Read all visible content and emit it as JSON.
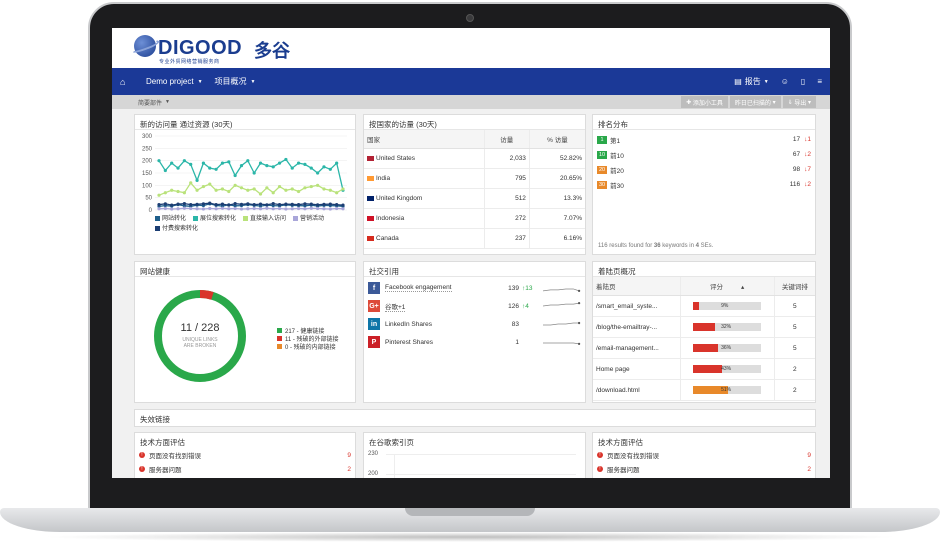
{
  "brand": {
    "name": "DIGOOD",
    "name_cn": "多谷",
    "tagline": "专业外贸网络营销服务商"
  },
  "nav": {
    "home_icon": "home-icon",
    "project": "Demo project",
    "overview": "项目概况",
    "report": "报告",
    "right_icons": [
      "users-icon",
      "book-icon",
      "menu-icon"
    ]
  },
  "toolbar": {
    "left": "简要部件",
    "add_widget": "添加小工具",
    "date": "昨日已扫描的",
    "export": "导出"
  },
  "traffic": {
    "title": "新的访问量 通过资源 (30天)",
    "chart_data": {
      "type": "line",
      "ylim": [
        0,
        300
      ],
      "yticks": [
        0,
        50,
        100,
        150,
        200,
        250,
        300
      ],
      "series": [
        {
          "name": "网站转化",
          "color": "#1f5f8b",
          "values": [
            15,
            18,
            16,
            22,
            17,
            15,
            20,
            18,
            25,
            19,
            16,
            21,
            17,
            18,
            22,
            19,
            16,
            20,
            18,
            17,
            21,
            19,
            18,
            17,
            20,
            16,
            19,
            18,
            17,
            15
          ]
        },
        {
          "name": "展位搜索转化",
          "color": "#2bb6a8",
          "values": [
            200,
            160,
            190,
            170,
            200,
            185,
            120,
            190,
            170,
            165,
            190,
            195,
            140,
            180,
            200,
            150,
            190,
            180,
            175,
            190,
            205,
            170,
            190,
            185,
            170,
            150,
            175,
            165,
            190,
            80
          ]
        },
        {
          "name": "直接输入访问",
          "color": "#b9e27a",
          "values": [
            60,
            70,
            80,
            75,
            70,
            110,
            80,
            95,
            105,
            80,
            85,
            75,
            100,
            90,
            80,
            85,
            65,
            90,
            70,
            95,
            80,
            85,
            75,
            90,
            95,
            100,
            85,
            80,
            70,
            85
          ]
        },
        {
          "name": "营销活动",
          "color": "#a9a6d9",
          "values": [
            5,
            6,
            4,
            5,
            7,
            6,
            5,
            4,
            6,
            5,
            7,
            5,
            6,
            4,
            5,
            6,
            5,
            7,
            5,
            6,
            4,
            5,
            6,
            5,
            7,
            6,
            5,
            4,
            6,
            5
          ]
        },
        {
          "name": "付费搜索转化",
          "color": "#1c3e73",
          "values": [
            22,
            25,
            20,
            24,
            26,
            22,
            23,
            25,
            28,
            22,
            24,
            20,
            26,
            23,
            25,
            22,
            24,
            21,
            26,
            22,
            24,
            23,
            22,
            25,
            24,
            21,
            23,
            24,
            22,
            20
          ]
        }
      ]
    }
  },
  "countries": {
    "title": "按国家的访量 (30天)",
    "headers": [
      "国家",
      "访量",
      "% 访量"
    ],
    "rows": [
      {
        "country": "United States",
        "visits": "2,033",
        "pct": "52.82%"
      },
      {
        "country": "India",
        "visits": "795",
        "pct": "20.65%"
      },
      {
        "country": "United Kingdom",
        "visits": "512",
        "pct": "13.3%"
      },
      {
        "country": "Indonesia",
        "visits": "272",
        "pct": "7.07%"
      },
      {
        "country": "Canada",
        "visits": "237",
        "pct": "6.16%"
      }
    ]
  },
  "ranking": {
    "title": "排名分布",
    "rows": [
      {
        "badge": "1",
        "label": "第1",
        "color": "#2aa84a",
        "value": "17",
        "delta": "1"
      },
      {
        "badge": "10",
        "label": "前10",
        "color": "#2aa84a",
        "value": "67",
        "delta": "2"
      },
      {
        "badge": "20",
        "label": "前20",
        "color": "#e8892a",
        "value": "98",
        "delta": "7"
      },
      {
        "badge": "30",
        "label": "前30",
        "color": "#e8892a",
        "value": "116",
        "delta": "2"
      }
    ],
    "footer_pre": "116 results found for ",
    "footer_kw": "36",
    "footer_mid": " keywords in ",
    "footer_se": "4",
    "footer_post": " SEs."
  },
  "health": {
    "title": "网站健康",
    "ratio": "11 / 228",
    "sub1": "UNIQUE LINKS",
    "sub2": "ARE BROKEN",
    "legend": [
      {
        "text": "217 - 健康链接",
        "color": "#2aa84a"
      },
      {
        "text": "11 - 残破的外部链接",
        "color": "#d9342b"
      },
      {
        "text": "0 - 残破的内部链接",
        "color": "#e8892a"
      }
    ],
    "healthy_fraction": 0.952
  },
  "social": {
    "title": "社交引用",
    "rows": [
      {
        "name": "Facebook engagement",
        "icon": "f",
        "color": "#3b5998",
        "value": "139",
        "delta": "13",
        "dir": "up"
      },
      {
        "name": "谷歌+1",
        "icon": "G+",
        "color": "#dd4b39",
        "value": "126",
        "delta": "4",
        "dir": "up"
      },
      {
        "name": "LinkedIn Shares",
        "icon": "in",
        "color": "#0e76a8",
        "value": "83",
        "delta": "",
        "dir": ""
      },
      {
        "name": "Pinterest Shares",
        "icon": "P",
        "color": "#cb2027",
        "value": "1",
        "delta": "",
        "dir": ""
      }
    ]
  },
  "landing": {
    "title": "着陆页概况",
    "headers": [
      "着陆页",
      "评分",
      "关键词排"
    ],
    "rows": [
      {
        "page": "/smart_email_syste...",
        "score": "9%",
        "fill": 0.09,
        "color": "#d9342b",
        "kw": "5"
      },
      {
        "page": "/blog/the-emailtray-...",
        "score": "32%",
        "fill": 0.32,
        "color": "#d9342b",
        "kw": "5"
      },
      {
        "page": "/email-management...",
        "score": "36%",
        "fill": 0.36,
        "color": "#d9342b",
        "kw": "5"
      },
      {
        "page": "Home page",
        "score": "43%",
        "fill": 0.43,
        "color": "#d9342b",
        "kw": "2"
      },
      {
        "page": "/download.html",
        "score": "51%",
        "fill": 0.51,
        "color": "#e8892a",
        "kw": "2"
      }
    ]
  },
  "broken_links": {
    "title": "失效链接"
  },
  "tech1": {
    "title": "技术方面评估",
    "rows": [
      {
        "text": "页面没有找到错误",
        "count": "9"
      },
      {
        "text": "服务器问题",
        "count": "2"
      }
    ]
  },
  "google_index": {
    "title": "在谷歌索引页",
    "chart_data": {
      "type": "line",
      "yticks": [
        "230",
        "200"
      ]
    }
  },
  "tech2": {
    "title": "技术方面评估",
    "rows": [
      {
        "text": "页面没有找到错误",
        "count": "9"
      },
      {
        "text": "服务器问题",
        "count": "2"
      }
    ]
  }
}
